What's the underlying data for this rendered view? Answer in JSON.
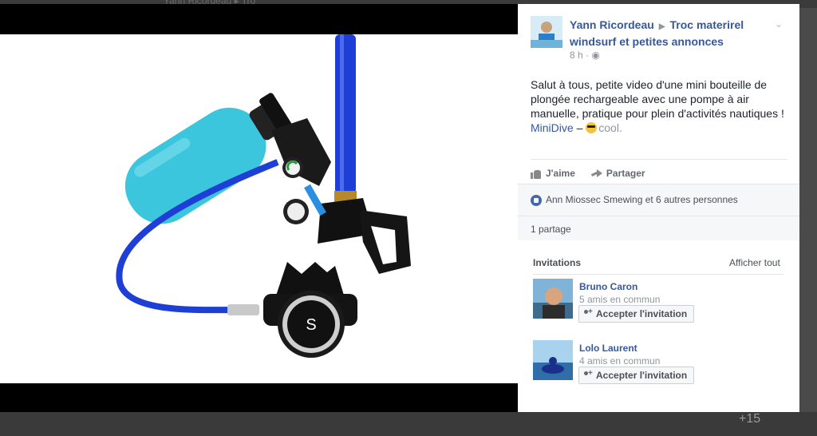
{
  "background": {
    "top_text": "Yann Ricordeau ▸ Tro",
    "counter": "+15"
  },
  "post": {
    "author": "Yann Ricordeau",
    "group": "Troc materirel windsurf et petites annonces",
    "time": "8 h",
    "audience_icon": "globe-icon",
    "text": "Salut à tous, petite video d'une mini bouteille de plongée rechargeable avec une pompe à air manuelle, pratique pour plein d'activités nautiques !",
    "link_text": "MiniDive",
    "dash": " – ",
    "emoji": "sunglasses-emoji",
    "emoji_suffix": "cool."
  },
  "actions": {
    "like": "J'aime",
    "share": "Partager"
  },
  "reactions": {
    "text": "Ann Miossec Smewing et 6 autres personnes"
  },
  "shares": {
    "text": "1 partage"
  },
  "invitations": {
    "title": "Invitations",
    "see_all": "Afficher tout",
    "items": [
      {
        "name": "Bruno Caron",
        "mutual": "5 amis en commun",
        "button": "Accepter l'invitation"
      },
      {
        "name": "Lolo Laurent",
        "mutual": "4 amis en commun",
        "button": "Accepter l'invitation"
      }
    ]
  },
  "colors": {
    "link_blue": "#365899",
    "like_blue": "#4267b2",
    "bottle_cyan": "#3cc6dd",
    "hose_blue": "#1d3fd6"
  }
}
